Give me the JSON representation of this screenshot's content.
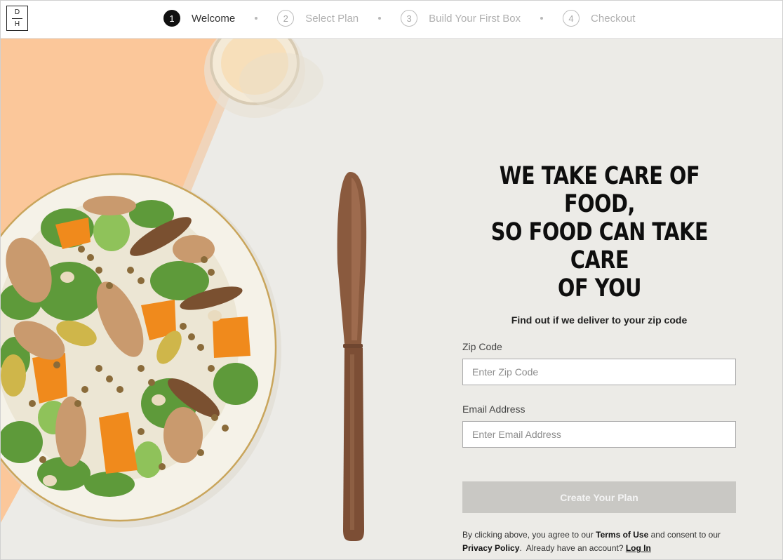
{
  "brand": {
    "logo_top": "D",
    "logo_bottom": "H"
  },
  "steps": [
    {
      "number": "1",
      "label": "Welcome",
      "active": true
    },
    {
      "number": "2",
      "label": "Select Plan",
      "active": false
    },
    {
      "number": "3",
      "label": "Build Your First Box",
      "active": false
    },
    {
      "number": "4",
      "label": "Checkout",
      "active": false
    }
  ],
  "hero": {
    "headline_line1": "WE TAKE CARE OF FOOD,",
    "headline_line2": "SO FOOD CAN TAKE CARE",
    "headline_line3": "OF YOU",
    "subheadline": "Find out if we deliver to your zip code"
  },
  "form": {
    "zip_label": "Zip Code",
    "zip_placeholder": "Enter Zip Code",
    "zip_value": "",
    "email_label": "Email Address",
    "email_placeholder": "Enter Email Address",
    "email_value": "",
    "submit_label": "Create Your Plan"
  },
  "legal": {
    "prefix": "By clicking above, you agree to our",
    "terms_link": "Terms of Use",
    "middle": "and consent to our",
    "privacy_link": "Privacy Policy",
    "account_prompt": "Already have an account?",
    "login_link": "Log In"
  },
  "colors": {
    "background": "#ecebe7",
    "peach": "#fbc79a",
    "button_disabled": "#c9c8c4",
    "active_step": "#111111"
  }
}
